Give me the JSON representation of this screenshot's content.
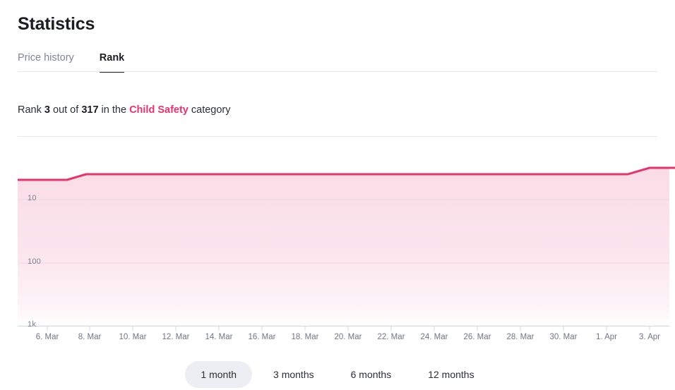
{
  "header": {
    "title": "Statistics"
  },
  "tabs": [
    {
      "label": "Price history",
      "active": false
    },
    {
      "label": "Rank",
      "active": true
    }
  ],
  "rank_summary": {
    "prefix": "Rank",
    "rank_value": "3",
    "middle": "out of",
    "total_value": "317",
    "in_the": "in the",
    "category": "Child Safety",
    "suffix": "category",
    "category_color": "#e8326b"
  },
  "chart_data": {
    "type": "area",
    "title": "",
    "xlabel": "",
    "ylabel": "",
    "y_scale": "log",
    "y_inverted": true,
    "y_ticks": [
      "10",
      "100",
      "1k"
    ],
    "y_tick_values": [
      10,
      100,
      1000
    ],
    "grid": true,
    "legend": false,
    "line_color": "#e8326b",
    "fill_color_top": "#fadfe8",
    "fill_color_bottom": "#ffffff",
    "x_tick_labels": [
      "6. Mar",
      "8. Mar",
      "10. Mar",
      "12. Mar",
      "14. Mar",
      "16. Mar",
      "18. Mar",
      "20. Mar",
      "22. Mar",
      "24. Mar",
      "26. Mar",
      "28. Mar",
      "30. Mar",
      "1. Apr",
      "3. Apr"
    ],
    "x": [
      "5. Mar",
      "6. Mar",
      "7. Mar",
      "8. Mar",
      "9. Mar",
      "10. Mar",
      "11. Mar",
      "12. Mar",
      "13. Mar",
      "14. Mar",
      "15. Mar",
      "16. Mar",
      "17. Mar",
      "18. Mar",
      "19. Mar",
      "20. Mar",
      "21. Mar",
      "22. Mar",
      "23. Mar",
      "24. Mar",
      "25. Mar",
      "26. Mar",
      "27. Mar",
      "28. Mar",
      "29. Mar",
      "30. Mar",
      "31. Mar",
      "1. Apr",
      "2. Apr",
      "3. Apr",
      "4. Apr"
    ],
    "values": [
      6,
      6,
      6,
      5,
      5,
      5,
      5,
      5,
      5,
      5,
      5,
      5,
      5,
      5,
      5,
      5,
      5,
      5,
      5,
      5,
      5,
      5,
      5,
      5,
      5,
      5,
      5,
      4,
      3,
      3,
      3
    ],
    "series": [
      {
        "name": "Rank",
        "values": [
          6,
          6,
          6,
          5,
          5,
          5,
          5,
          5,
          5,
          5,
          5,
          5,
          5,
          5,
          5,
          5,
          5,
          5,
          5,
          5,
          5,
          5,
          5,
          5,
          5,
          5,
          5,
          4,
          3,
          3,
          3
        ]
      }
    ]
  },
  "ranges": [
    {
      "label": "1 month",
      "selected": true
    },
    {
      "label": "3 months",
      "selected": false
    },
    {
      "label": "6 months",
      "selected": false
    },
    {
      "label": "12 months",
      "selected": false
    }
  ]
}
